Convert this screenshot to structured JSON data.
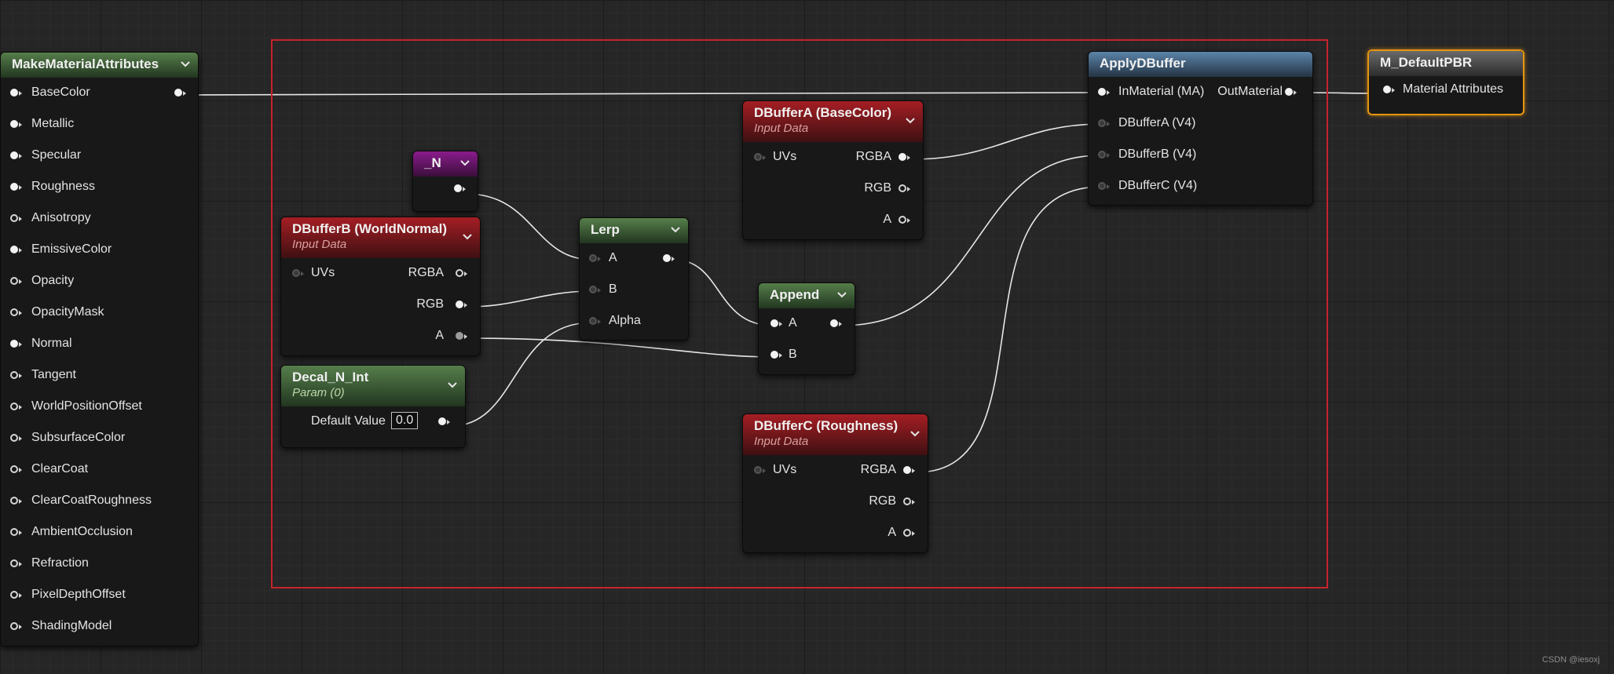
{
  "watermark": "CSDN @iesoxj",
  "nodes": {
    "make_material_attributes": {
      "title": "MakeMaterialAttributes",
      "inputs": [
        "BaseColor",
        "Metallic",
        "Specular",
        "Roughness",
        "Anisotropy",
        "EmissiveColor",
        "Opacity",
        "OpacityMask",
        "Normal",
        "Tangent",
        "WorldPositionOffset",
        "SubsurfaceColor",
        "ClearCoat",
        "ClearCoatRoughness",
        "AmbientOcclusion",
        "Refraction",
        "PixelDepthOffset",
        "ShadingModel"
      ]
    },
    "n_param": {
      "title": "_N"
    },
    "dbuffer_b": {
      "title": "DBufferB (WorldNormal)",
      "subtitle": "Input Data",
      "input": "UVs",
      "outputs": [
        "RGBA",
        "RGB",
        "A"
      ]
    },
    "decal_n_int": {
      "title": "Decal_N_Int",
      "subtitle": "Param (0)",
      "default_label": "Default Value",
      "default_value": "0.0"
    },
    "lerp": {
      "title": "Lerp",
      "inputs": [
        "A",
        "B",
        "Alpha"
      ]
    },
    "dbuffer_a": {
      "title": "DBufferA (BaseColor)",
      "subtitle": "Input Data",
      "input": "UVs",
      "outputs": [
        "RGBA",
        "RGB",
        "A"
      ]
    },
    "append": {
      "title": "Append",
      "inputs": [
        "A",
        "B"
      ]
    },
    "dbuffer_c": {
      "title": "DBufferC (Roughness)",
      "subtitle": "Input Data",
      "input": "UVs",
      "outputs": [
        "RGBA",
        "RGB",
        "A"
      ]
    },
    "apply_dbuffer": {
      "title": "ApplyDBuffer",
      "inputs": [
        "InMaterial (MA)",
        "DBufferA (V4)",
        "DBufferB (V4)",
        "DBufferC (V4)"
      ],
      "output": "OutMaterial"
    },
    "result": {
      "title": "M_DefaultPBR",
      "input": "Material Attributes"
    }
  },
  "colors": {
    "selection": "#c8232b",
    "selected_outline": "#e59612",
    "wire": "#e6e6e6"
  }
}
